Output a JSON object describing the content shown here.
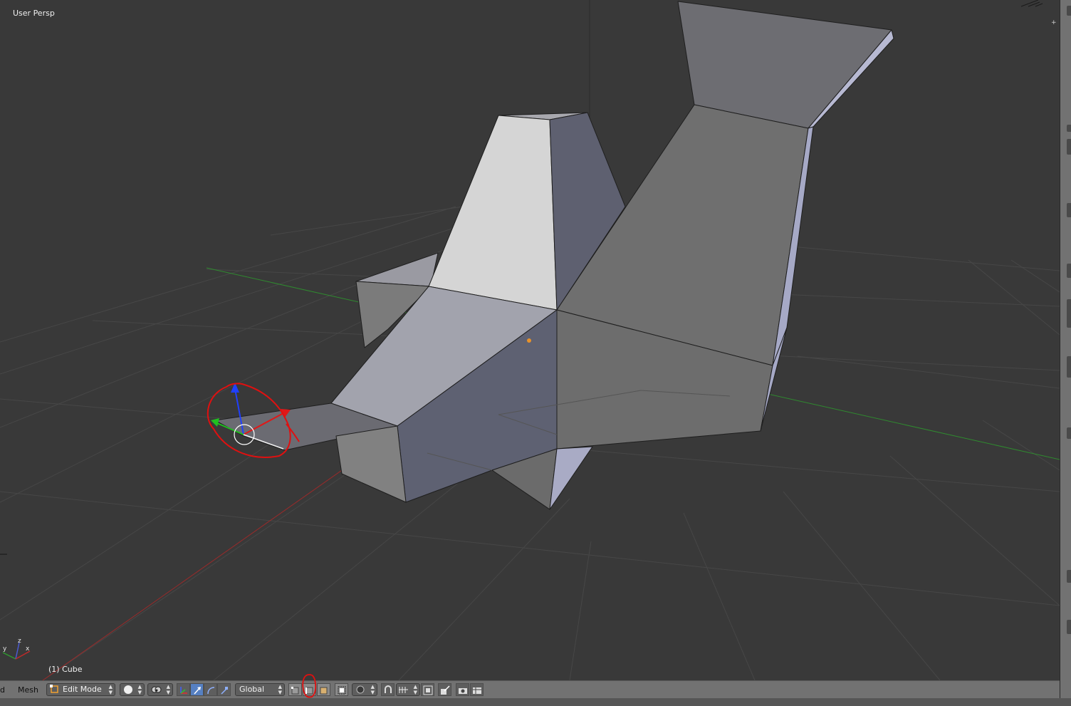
{
  "viewport": {
    "view_label": "User Persp",
    "object_label": "(1) Cube",
    "axis_widget": {
      "x": "x",
      "y": "y",
      "z": "z"
    }
  },
  "header": {
    "editor_type_partial": "d",
    "mesh_menu": "Mesh",
    "mode_selector": "Edit Mode",
    "viewport_shading_icon": "solid-sphere-icon",
    "pivot_point_icon": "pivot-point-icon",
    "manipulator_icons": [
      "manipulator-toggle-icon",
      "translate-manipulator-icon",
      "rotate-manipulator-icon",
      "scale-manipulator-icon"
    ],
    "orientation": "Global",
    "select_mode_icons": [
      "vertex-select-icon",
      "edge-select-icon",
      "face-select-icon"
    ],
    "occlude_geometry_icon": "occlude-geometry-icon",
    "proportional_edit_icon": "proportional-edit-icon",
    "snap_icons": [
      "snap-toggle-icon",
      "snap-element-icon",
      "snap-target-icon"
    ],
    "extra_icons": [
      "mesh-options-icon",
      "render-preview-icon",
      "render-animation-icon"
    ]
  },
  "colors": {
    "background": "#393939",
    "grid": "#474747",
    "x_axis": "#9a2a2a",
    "y_axis": "#2f8a2f",
    "header": "#727272",
    "selection_highlight": "#5680c2",
    "annotation": "#e01010"
  }
}
